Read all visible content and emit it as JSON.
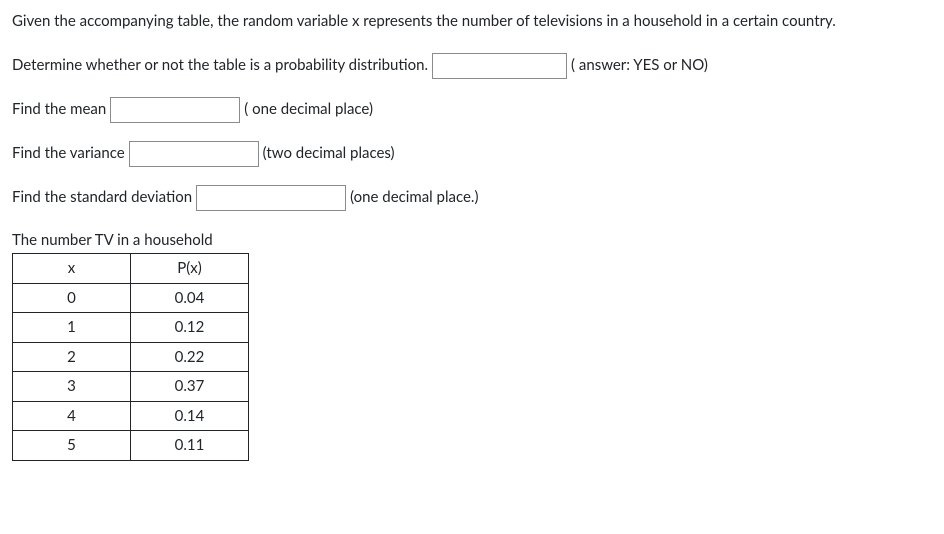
{
  "intro": "Given the accompanying table, the random variable x represents the number of televisions in a household in a certain country.",
  "q1": {
    "prompt": "Determine whether or not the table is a probability distribution.",
    "hint": "( answer: YES or NO)"
  },
  "q2": {
    "prompt": "Find the mean",
    "hint": "( one decimal place)"
  },
  "q3": {
    "prompt": "Find the variance",
    "hint": "(two decimal places)"
  },
  "q4": {
    "prompt": "Find the standard deviation",
    "hint": "(one decimal place.)"
  },
  "table": {
    "caption": "The number TV in a household",
    "headers": {
      "col1": "x",
      "col2": "P(x)"
    },
    "rows": [
      {
        "x": "0",
        "p": "0.04"
      },
      {
        "x": "1",
        "p": "0.12"
      },
      {
        "x": "2",
        "p": "0.22"
      },
      {
        "x": "3",
        "p": "0.37"
      },
      {
        "x": "4",
        "p": "0.14"
      },
      {
        "x": "5",
        "p": "0.11"
      }
    ]
  },
  "chart_data": {
    "type": "table",
    "title": "The number TV in a household",
    "columns": [
      "x",
      "P(x)"
    ],
    "rows": [
      [
        0,
        0.04
      ],
      [
        1,
        0.12
      ],
      [
        2,
        0.22
      ],
      [
        3,
        0.37
      ],
      [
        4,
        0.14
      ],
      [
        5,
        0.11
      ]
    ]
  }
}
